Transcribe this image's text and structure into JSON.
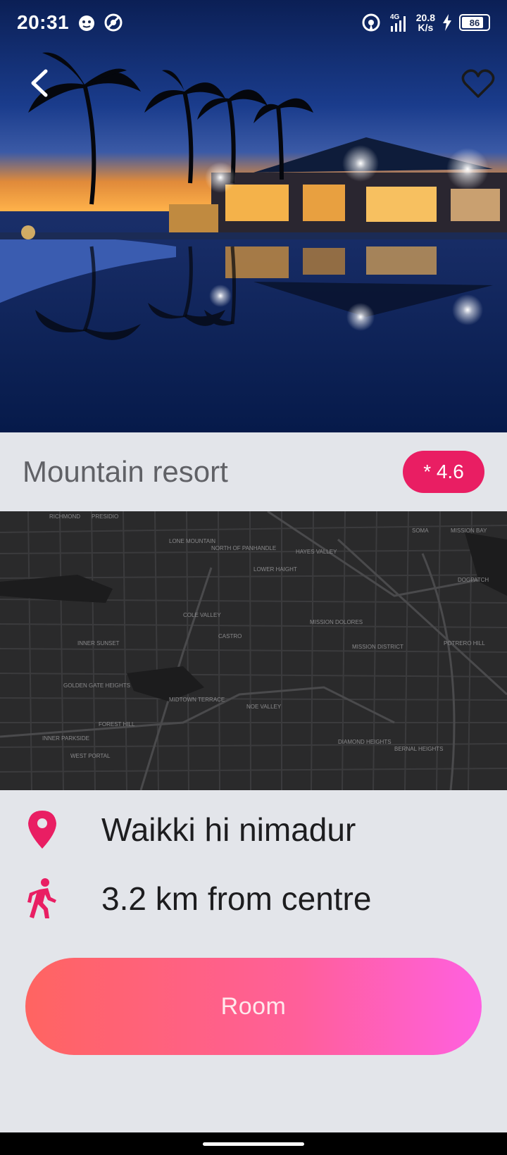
{
  "status_bar": {
    "time": "20:31",
    "network_type": "4G",
    "net_speed_value": "20.8",
    "net_speed_unit": "K/s",
    "battery_level": "86"
  },
  "hotel": {
    "name": "Mountain resort",
    "rating_label": "* 4.6"
  },
  "details": {
    "location": "Waikki hi nimadur",
    "distance": "3.2 km from centre"
  },
  "actions": {
    "room_button_label": "Room"
  },
  "colors": {
    "accent": "#e91e63",
    "button_gradient_start": "#ff6461",
    "button_gradient_end": "#ff60e0",
    "background": "#e3e5ea",
    "map_background": "#2a2a2b"
  },
  "map": {
    "labels": [
      "RICHMOND",
      "PRESIDIO",
      "LONE MOUNTAIN",
      "NORTH OF PANHANDLE",
      "LOWER HAIGHT",
      "HAYES VALLEY",
      "SOMA",
      "MISSION BAY",
      "COLE VALLEY",
      "CASTRO",
      "MISSION DOLORES",
      "DOGPATCH",
      "INNER SUNSET",
      "POTRERO HILL",
      "GOLDEN GATE HEIGHTS",
      "MIDTOWN TERRACE",
      "NOE VALLEY",
      "MISSION DISTRICT",
      "FOREST HILL",
      "INNER PARKSIDE",
      "WEST PORTAL",
      "DIAMOND HEIGHTS",
      "BERNAL HEIGHTS"
    ]
  }
}
